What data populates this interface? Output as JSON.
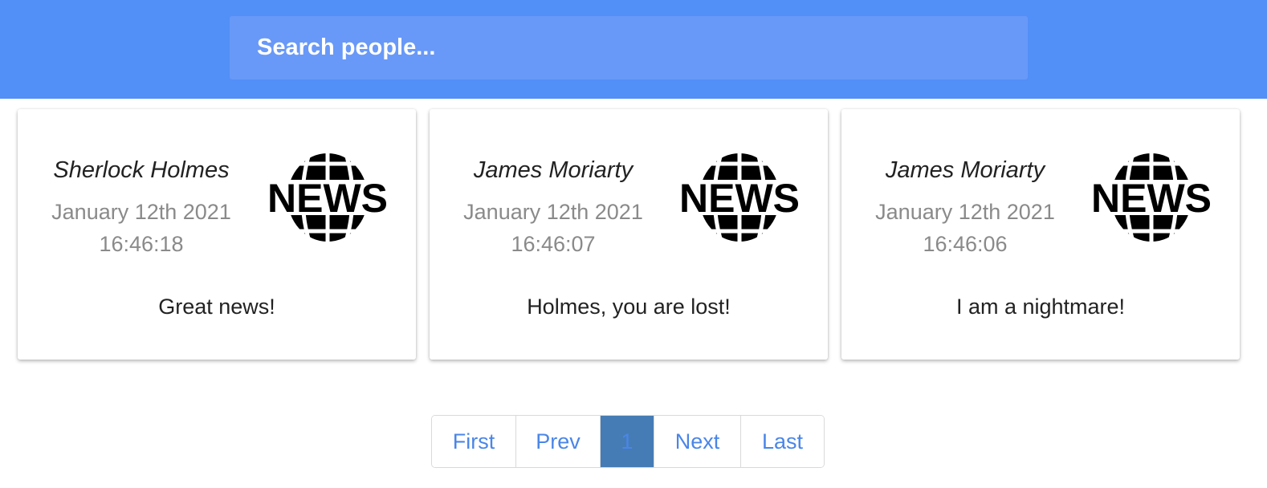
{
  "search": {
    "placeholder": "Search people...",
    "value": ""
  },
  "posts": [
    {
      "author": "Sherlock Holmes",
      "date": "January 12th 2021",
      "time": "16:46:18",
      "logo_text": "NEWS",
      "message": "Great news!"
    },
    {
      "author": "James Moriarty",
      "date": "January 12th 2021",
      "time": "16:46:07",
      "logo_text": "NEWS",
      "message": "Holmes, you are lost!"
    },
    {
      "author": "James Moriarty",
      "date": "January 12th 2021",
      "time": "16:46:06",
      "logo_text": "NEWS",
      "message": "I am a nightmare!"
    }
  ],
  "pagination": {
    "first": "First",
    "prev": "Prev",
    "current": "1",
    "next": "Next",
    "last": "Last"
  },
  "colors": {
    "header_bg": "#528ff7",
    "search_bg": "#6899f8",
    "link": "#4a86e8",
    "active_page_bg": "#467cb5"
  }
}
